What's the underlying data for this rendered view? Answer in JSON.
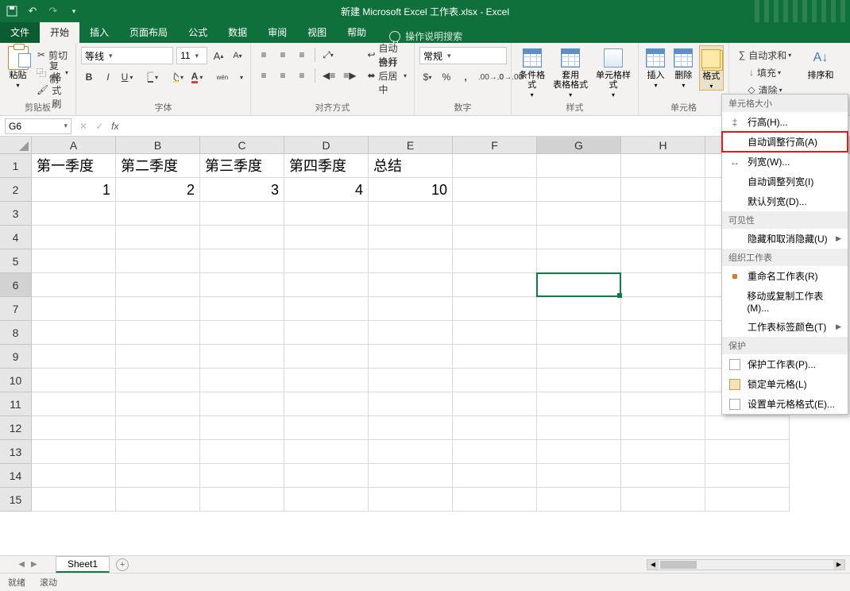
{
  "title": "新建 Microsoft Excel 工作表.xlsx  -  Excel",
  "tabs": {
    "file": "文件",
    "home": "开始",
    "insert": "插入",
    "layout": "页面布局",
    "formulas": "公式",
    "data": "数据",
    "review": "审阅",
    "view": "视图",
    "help": "帮助"
  },
  "tell_me": "操作说明搜索",
  "ribbon": {
    "clipboard": {
      "paste": "粘贴",
      "cut": "剪切",
      "copy": "复制",
      "painter": "格式刷",
      "label": "剪贴板"
    },
    "font": {
      "name": "等线",
      "size": "11",
      "label": "字体"
    },
    "align": {
      "wrap": "自动换行",
      "merge": "合并后居中",
      "label": "对齐方式"
    },
    "number": {
      "format": "常规",
      "label": "数字"
    },
    "styles": {
      "cond": "条件格式",
      "table": "套用\n表格格式",
      "cell": "单元格样式",
      "label": "样式"
    },
    "cells": {
      "insert": "插入",
      "delete": "删除",
      "format": "格式",
      "label": "单元格"
    },
    "editing": {
      "autosum": "自动求和",
      "fill": "填充",
      "clear": "清除",
      "sort": "排序和"
    }
  },
  "namebox": "G6",
  "columns": [
    "A",
    "B",
    "C",
    "D",
    "E",
    "F",
    "G",
    "H"
  ],
  "rows_visible": 15,
  "selected": {
    "row": 6,
    "col": 7
  },
  "data_rows": [
    {
      "A": "第一季度",
      "B": "第二季度",
      "C": "第三季度",
      "D": "第四季度",
      "E": "总结"
    },
    {
      "A": "1",
      "B": "2",
      "C": "3",
      "D": "4",
      "E": "10"
    }
  ],
  "sheet": "Sheet1",
  "status": {
    "ready": "就绪",
    "scroll": "滚动"
  },
  "menu": {
    "s1": "单元格大小",
    "row_height": "行高(H)...",
    "auto_row": "自动调整行高(A)",
    "col_width": "列宽(W)...",
    "auto_col": "自动调整列宽(I)",
    "default_col": "默认列宽(D)...",
    "s2": "可见性",
    "hide": "隐藏和取消隐藏(U)",
    "s3": "组织工作表",
    "rename": "重命名工作表(R)",
    "move": "移动或复制工作表(M)...",
    "tab_color": "工作表标签颜色(T)",
    "s4": "保护",
    "protect": "保护工作表(P)...",
    "lock": "锁定单元格(L)",
    "format_cells": "设置单元格格式(E)..."
  }
}
